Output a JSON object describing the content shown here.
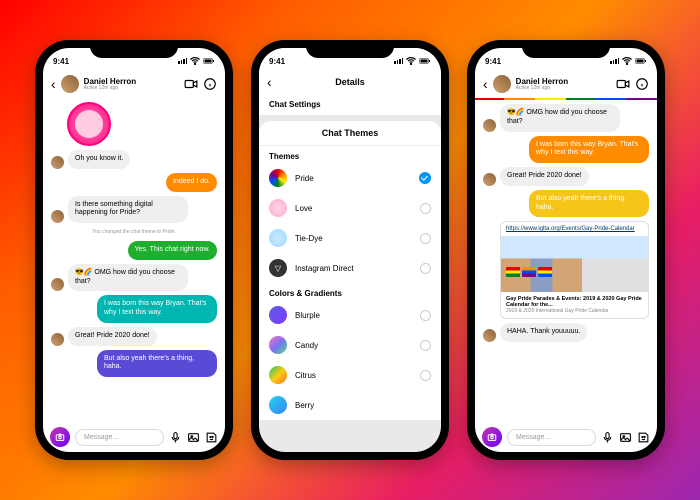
{
  "status": {
    "time": "9:41"
  },
  "chat": {
    "name": "Daniel Herron",
    "presence": "Active 12m ago",
    "composer_placeholder": "Message...",
    "sys_msg": "You changed the chat theme to Pride.",
    "p1": {
      "m1": "Oh you know it.",
      "m2": "Indeed I do.",
      "m3": "Is there something digital happening for Pride?",
      "m4": "Yes. This chat right now.",
      "m5": "😎🌈 OMG how did you choose that?",
      "m6": "I was born this way Bryan. That's why I text this way.",
      "m7": "Great! Pride 2020 done!",
      "m8": "But also yeah there's a thing, haha."
    },
    "p3": {
      "m1": "😎🌈 OMG how did you choose that?",
      "m2": "I was born this way Bryan. That's why I text this way.",
      "m3": "Great! Pride 2020 done!",
      "m4": "But also yeah there's a thing, haha.",
      "link_url": "https://www.iglta.org/Events/Gay-Pride-Calendar",
      "link_title": "Gay Pride Parades & Events: 2019 & 2020 Gay Pride Calendar for the...",
      "link_desc": "2019 & 2020 International Gay Pride Calendar",
      "m5": "HAHA. Thank youuuuu."
    }
  },
  "details": {
    "title": "Details",
    "settings": "Chat Settings",
    "themes_head": "Chat Themes",
    "themes_label": "Themes",
    "colors_label": "Colors & Gradients",
    "items": {
      "pride": "Pride",
      "love": "Love",
      "tiedye": "Tie-Dye",
      "igd": "Instagram Direct",
      "blurple": "Blurple",
      "candy": "Candy",
      "citrus": "Citrus",
      "berry": "Berry"
    }
  }
}
